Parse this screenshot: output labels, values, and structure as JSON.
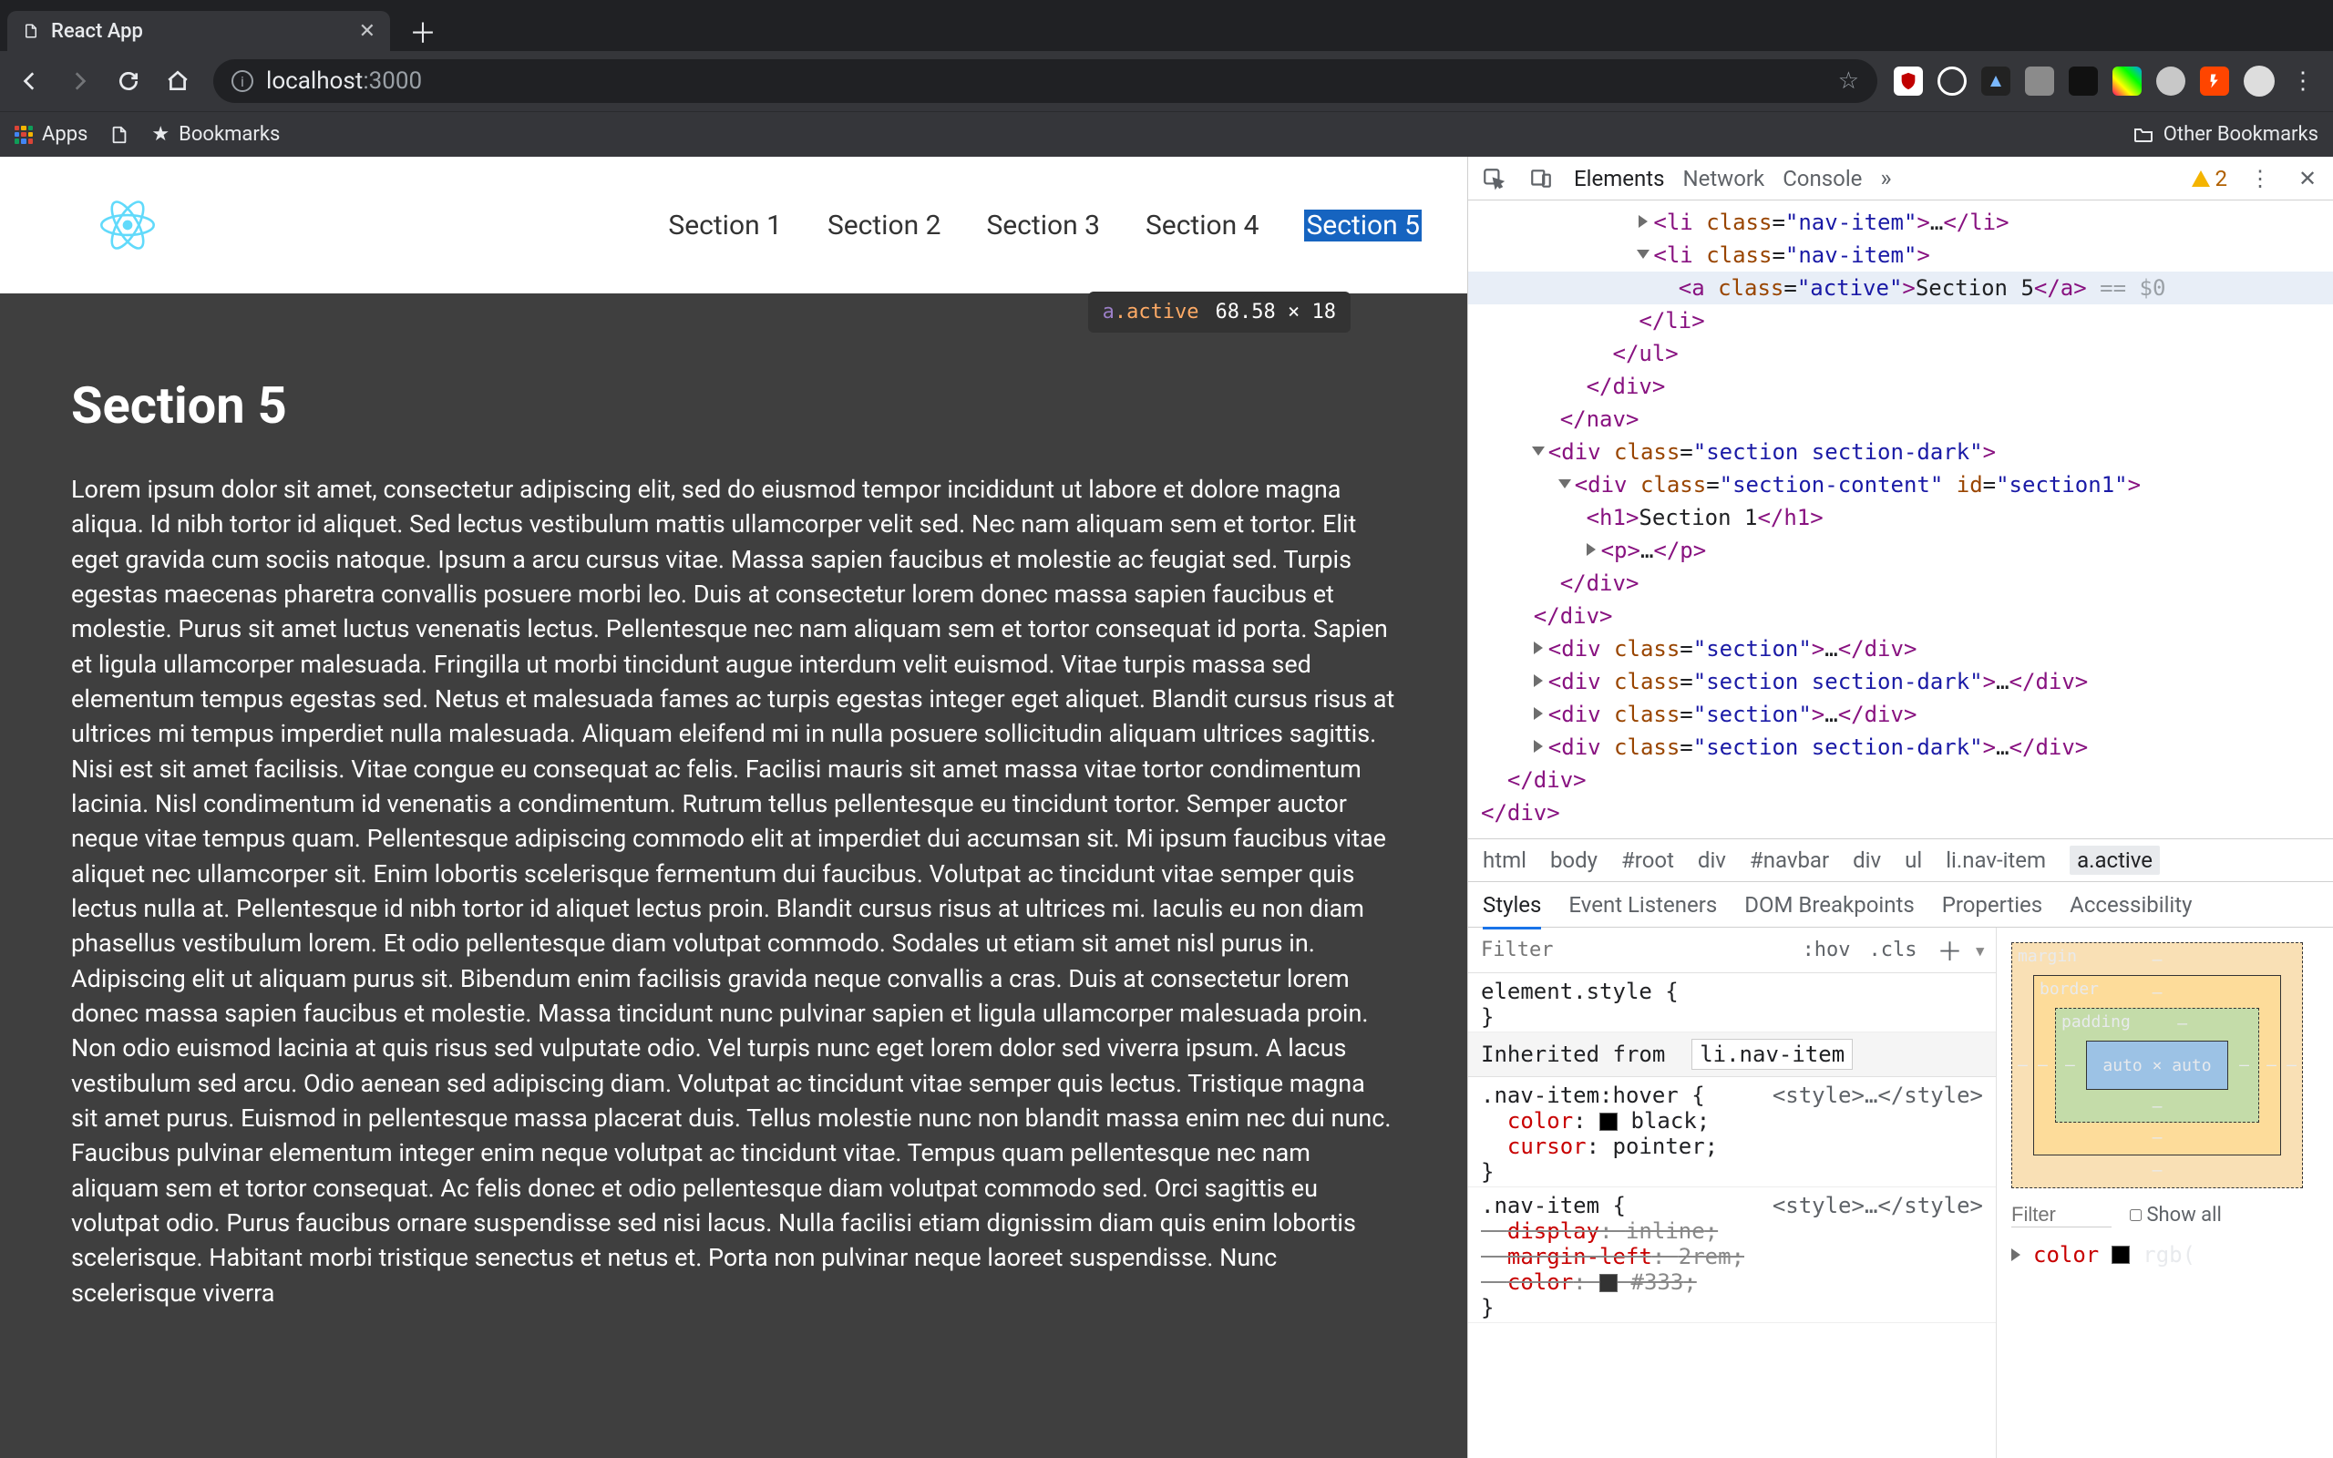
{
  "browser": {
    "tab_title": "React App",
    "url_host": "localhost",
    "url_port": ":3000",
    "bookmarks": {
      "apps": "Apps",
      "bookmarks": "Bookmarks",
      "other": "Other Bookmarks"
    },
    "warnings": "2"
  },
  "page": {
    "nav_items": [
      "Section 1",
      "Section 2",
      "Section 3",
      "Section 4",
      "Section 5"
    ],
    "active_index": 4,
    "section_title": "Section 5",
    "section_body": "Lorem ipsum dolor sit amet, consectetur adipiscing elit, sed do eiusmod tempor incididunt ut labore et dolore magna aliqua. Id nibh tortor id aliquet. Sed lectus vestibulum mattis ullamcorper velit sed. Nec nam aliquam sem et tortor. Elit eget gravida cum sociis natoque. Ipsum a arcu cursus vitae. Massa sapien faucibus et molestie ac feugiat sed. Turpis egestas maecenas pharetra convallis posuere morbi leo. Duis at consectetur lorem donec massa sapien faucibus et molestie. Purus sit amet luctus venenatis lectus. Pellentesque nec nam aliquam sem et tortor consequat id porta. Sapien et ligula ullamcorper malesuada. Fringilla ut morbi tincidunt augue interdum velit euismod. Vitae turpis massa sed elementum tempus egestas sed. Netus et malesuada fames ac turpis egestas integer eget aliquet. Blandit cursus risus at ultrices mi tempus imperdiet nulla malesuada. Aliquam eleifend mi in nulla posuere sollicitudin aliquam ultrices sagittis. Nisi est sit amet facilisis. Vitae congue eu consequat ac felis. Facilisi mauris sit amet massa vitae tortor condimentum lacinia. Nisl condimentum id venenatis a condimentum. Rutrum tellus pellentesque eu tincidunt tortor. Semper auctor neque vitae tempus quam. Pellentesque adipiscing commodo elit at imperdiet dui accumsan sit. Mi ipsum faucibus vitae aliquet nec ullamcorper sit. Enim lobortis scelerisque fermentum dui faucibus. Volutpat ac tincidunt vitae semper quis lectus nulla at. Pellentesque id nibh tortor id aliquet lectus proin. Blandit cursus risus at ultrices mi. Iaculis eu non diam phasellus vestibulum lorem. Et odio pellentesque diam volutpat commodo. Sodales ut etiam sit amet nisl purus in. Adipiscing elit ut aliquam purus sit. Bibendum enim facilisis gravida neque convallis a cras. Duis at consectetur lorem donec massa sapien faucibus et molestie. Massa tincidunt nunc pulvinar sapien et ligula ullamcorper malesuada proin. Non odio euismod lacinia at quis risus sed vulputate odio. Vel turpis nunc eget lorem dolor sed viverra ipsum. A lacus vestibulum sed arcu. Odio aenean sed adipiscing diam. Volutpat ac tincidunt vitae semper quis lectus. Tristique magna sit amet purus. Euismod in pellentesque massa placerat duis. Tellus molestie nunc non blandit massa enim nec dui nunc. Faucibus pulvinar elementum integer enim neque volutpat ac tincidunt vitae. Tempus quam pellentesque nec nam aliquam sem et tortor consequat. Ac felis donec et odio pellentesque diam volutpat commodo sed. Orci sagittis eu volutpat odio. Purus faucibus ornare suspendisse sed nisi lacus. Nulla facilisi etiam dignissim diam quis enim lobortis scelerisque. Habitant morbi tristique senectus et netus et. Porta non pulvinar neque laoreet suspendisse. Nunc scelerisque viverra"
  },
  "inspect_tooltip": {
    "selector_tag": "a",
    "selector_class": ".active",
    "dimensions": "68.58 × 18"
  },
  "devtools": {
    "tabs": [
      "Elements",
      "Network",
      "Console"
    ],
    "active_tab": "Elements",
    "breadcrumb": [
      "html",
      "body",
      "#root",
      "div",
      "#navbar",
      "div",
      "ul",
      "li.nav-item",
      "a.active"
    ],
    "subtabs": [
      "Styles",
      "Event Listeners",
      "DOM Breakpoints",
      "Properties",
      "Accessibility"
    ],
    "active_subtab": "Styles",
    "filter_placeholder": "Filter",
    "hov_label": ":hov",
    "cls_label": ".cls",
    "box_filter_placeholder": "Filter",
    "show_all_label": "Show all",
    "styles": {
      "element_style": "element.style {",
      "inherited_label": "Inherited from",
      "inherited_selector": "li.nav-item",
      "rule1_selector": ".nav-item:hover {",
      "rule1_source": "<style>…</style>",
      "rule1_props": [
        {
          "prop": "color",
          "val": "black",
          "swatch": "#000000"
        },
        {
          "prop": "cursor",
          "val": "pointer"
        }
      ],
      "rule2_selector": ".nav-item {",
      "rule2_source": "<style>…</style>",
      "rule2_props": [
        {
          "prop": "display",
          "val": "inline",
          "strike": true
        },
        {
          "prop": "margin-left",
          "val": "2rem",
          "strike": true
        },
        {
          "prop": "color",
          "val": "#333",
          "swatch": "#333333",
          "strike": true
        }
      ],
      "tail_prop": "color",
      "tail_val": "rgb("
    },
    "boxmodel": {
      "margin_label": "margin",
      "border_label": "border",
      "padding_label": "padding",
      "content": "auto × auto",
      "dash": "–"
    },
    "dom": {
      "li_open": "<li class=\"nav-item\">…</li>",
      "li_open2": "<li class=\"nav-item\">",
      "a_active_open": "<a class=\"active\">",
      "a_active_text": "Section 5",
      "a_close": "</a>",
      "eq0": " == $0",
      "li_close": "</li>",
      "ul_close": "</ul>",
      "div_close": "</div>",
      "nav_close": "</nav>",
      "sec_dark": "<div class=\"section section-dark\">",
      "sec_content": "<div class=\"section-content\" id=\"section1\">",
      "h1_sec1": "<h1>Section 1</h1>",
      "p_ell": "<p>…</p>",
      "sec_plain": "<div class=\"section\">…</div>",
      "sec_dark_ell": "<div class=\"section section-dark\">…</div>"
    }
  }
}
